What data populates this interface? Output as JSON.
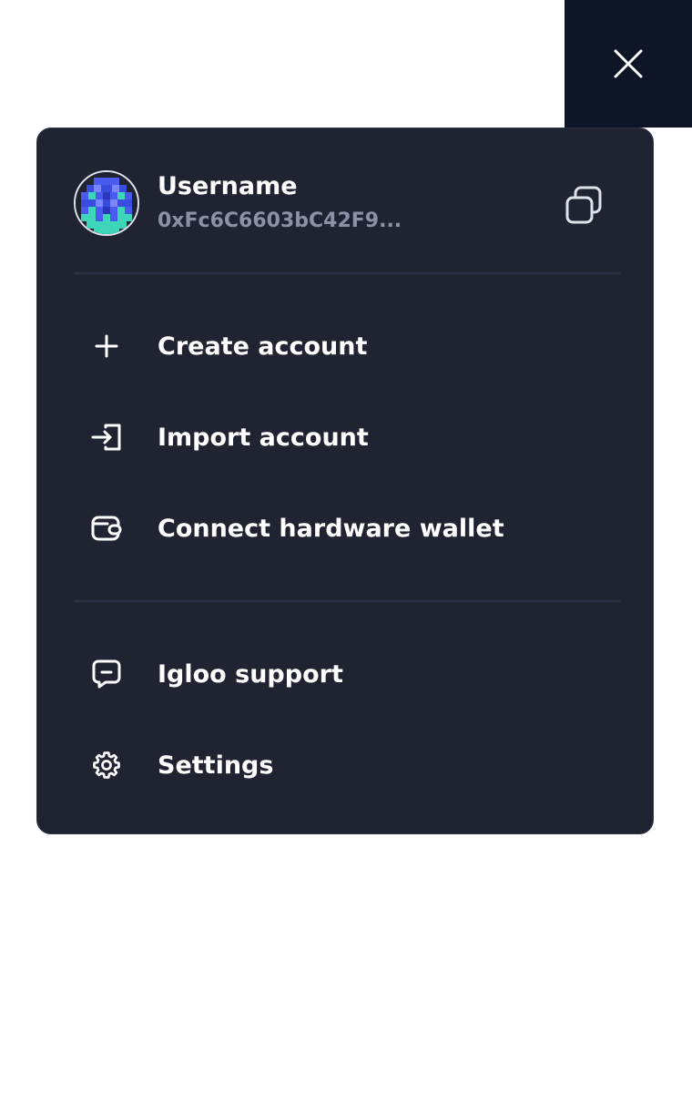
{
  "close": {
    "icon": "close-icon"
  },
  "profile": {
    "username": "Username",
    "address": "0xFc6C6603bC42F9...",
    "avatar_icon": "pixel-avatar",
    "copy_icon": "copy-icon"
  },
  "menu": {
    "items": [
      {
        "label": "Create account",
        "icon": "plus-icon"
      },
      {
        "label": "Import account",
        "icon": "import-icon"
      },
      {
        "label": "Connect hardware wallet",
        "icon": "wallet-icon"
      },
      {
        "label": "Igloo support",
        "icon": "chat-icon"
      },
      {
        "label": "Settings",
        "icon": "gear-icon"
      }
    ]
  },
  "colors": {
    "panel_bg": "#1f2332",
    "close_bg": "#0e1526",
    "text": "#ffffff",
    "muted_text": "#8c92a6",
    "divider": "#2c3246",
    "avatar_blue": "#3a4be0",
    "avatar_teal": "#3ed6b8"
  }
}
